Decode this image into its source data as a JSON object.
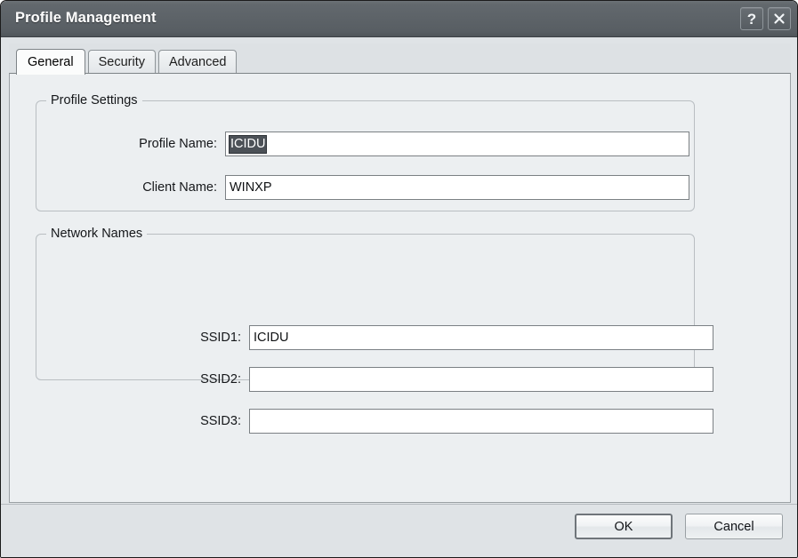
{
  "window": {
    "title": "Profile Management",
    "help_button": "?",
    "close_button": "×"
  },
  "tabs": [
    {
      "label": "General",
      "active": true
    },
    {
      "label": "Security",
      "active": false
    },
    {
      "label": "Advanced",
      "active": false
    }
  ],
  "groups": {
    "profile_settings": {
      "legend": "Profile Settings",
      "fields": [
        {
          "label": "Profile Name:",
          "value": "ICIDU",
          "selected": true
        },
        {
          "label": "Client Name:",
          "value": "WINXP",
          "selected": false
        }
      ]
    },
    "network_names": {
      "legend": "Network Names",
      "fields": [
        {
          "label": "SSID1:",
          "value": "ICIDU",
          "selected": false
        },
        {
          "label": "SSID2:",
          "value": "",
          "selected": false
        },
        {
          "label": "SSID3:",
          "value": "",
          "selected": false
        }
      ]
    }
  },
  "footer": {
    "ok_label": "OK",
    "cancel_label": "Cancel"
  },
  "colors": {
    "titlebar": "#5c6267",
    "dialog_background": "#dfe3e6",
    "panel_background": "#eceff1",
    "selection_highlight": "#4c5157",
    "field_border": "#7b8084"
  }
}
